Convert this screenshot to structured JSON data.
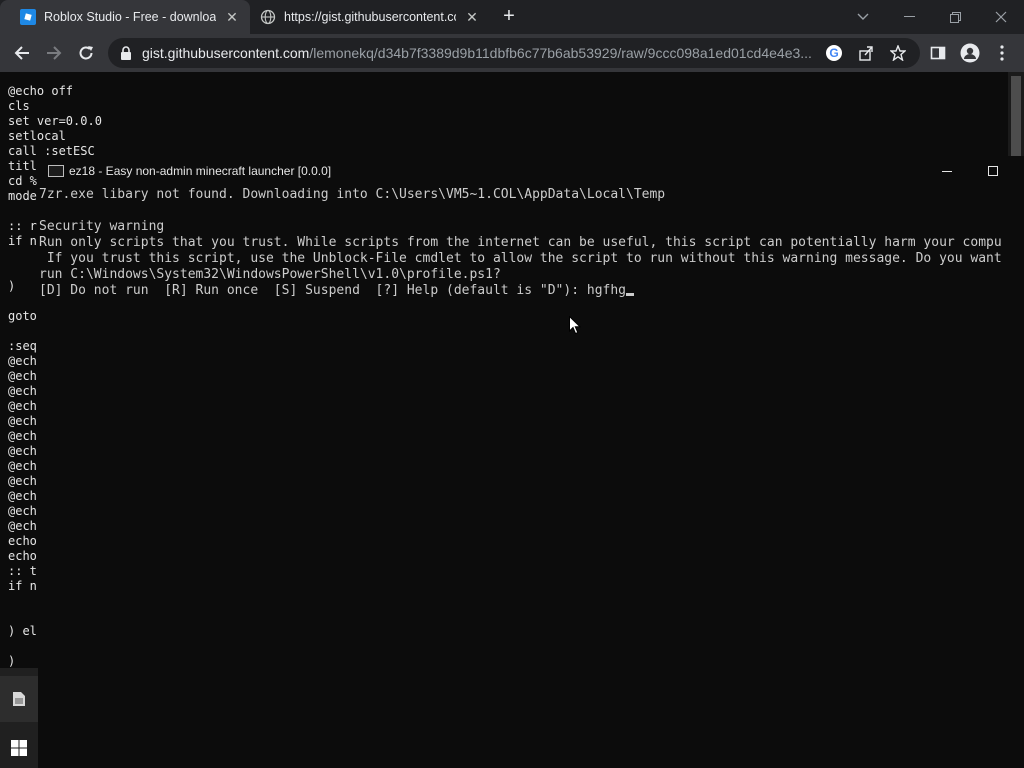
{
  "browser": {
    "tabs": [
      {
        "title": "Roblox Studio - Free - download",
        "icon": "roblox-studio-icon",
        "active": true
      },
      {
        "title": "https://gist.githubusercontent.co",
        "icon": "globe-icon",
        "active": false
      }
    ],
    "address": {
      "host": "gist.githubusercontent.com",
      "path": "/lemonekq/d34b7f3389d9b11dbfb6c77b6ab53929/raw/9ccc098a1ed01cd4e4e3..."
    }
  },
  "page": {
    "code_lines": [
      "@echo off",
      "cls",
      "set ver=0.0.0",
      "setlocal",
      "call :setESC",
      "titl",
      "cd %",
      "mode",
      "",
      ":: r",
      "if n",
      "",
      "",
      ")",
      "",
      "goto",
      "",
      ":seq",
      "@ech",
      "@ech",
      "@ech",
      "@ech",
      "@ech",
      "@ech",
      "@ech",
      "@ech",
      "@ech",
      "@ech",
      "@ech",
      "@ech",
      "echo",
      "echo",
      ":: t",
      "if n",
      "",
      "",
      ") el",
      "",
      ")"
    ]
  },
  "console": {
    "title": "ez18 - Easy non-admin minecraft launcher [0.0.0]",
    "lines": [
      "7zr.exe libary not found. Downloading into C:\\Users\\VM5~1.COL\\AppData\\Local\\Temp",
      "",
      "Security warning",
      "Run only scripts that you trust. While scripts from the internet can be useful, this script can potentially harm your compu",
      " If you trust this script, use the Unblock-File cmdlet to allow the script to run without this warning message. Do you want",
      "run C:\\Windows\\System32\\WindowsPowerShell\\v1.0\\profile.ps1?",
      "[D] Do not run  [R] Run once  [S] Suspend  [?] Help (default is \"D\"): hgfhg"
    ]
  },
  "colors": {
    "chrome_dark": "#202124",
    "chrome_toolbar": "#35363a",
    "console_bg": "#0c0c0c",
    "console_text": "#cccccc"
  }
}
